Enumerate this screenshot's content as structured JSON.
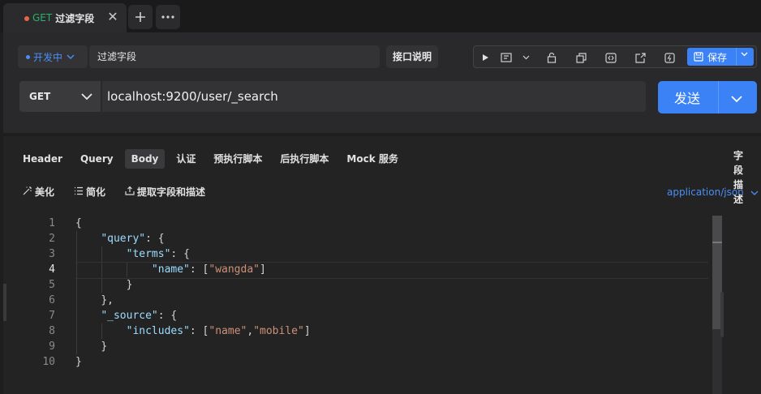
{
  "tab": {
    "method": "GET",
    "title": "过滤字段"
  },
  "request": {
    "environment": "开发中",
    "name": "过滤字段",
    "doc_button": "接口说明",
    "save_label": "保存",
    "method": "GET",
    "url": "localhost:9200/user/_search",
    "send_label": "发送"
  },
  "body_tabs": [
    "Header",
    "Query",
    "Body",
    "认证",
    "预执行脚本",
    "后执行脚本",
    "Mock 服务"
  ],
  "active_body_tab": "Body",
  "actions": {
    "beautify": "美化",
    "simplify": "简化",
    "extract": "提取字段和描述"
  },
  "content_type": "application/json",
  "side_panel_label": "字段描述",
  "line_numbers": [
    "1",
    "2",
    "3",
    "4",
    "5",
    "6",
    "7",
    "8",
    "9",
    "10"
  ],
  "current_line": 4,
  "code": {
    "l1": "{",
    "l2_key": "\"query\"",
    "l2_rest": ": {",
    "l3_key": "\"terms\"",
    "l3_rest": ": {",
    "l4_key": "\"name\"",
    "l4_colon": ": [",
    "l4_val": "\"wangda\"",
    "l4_end": "]",
    "l5": "}",
    "l6": "},",
    "l7_key": "\"_source\"",
    "l7_rest": ": {",
    "l8_key": "\"includes\"",
    "l8_colon": ": [",
    "l8_v1": "\"name\"",
    "l8_comma": ",",
    "l8_v2": "\"mobile\"",
    "l8_end": "]",
    "l9": "}",
    "l10": "}"
  },
  "colors": {
    "accent": "#3b82f6",
    "method_get": "#28b26b",
    "unsaved_dot": "#e5664a",
    "json_key": "#9cdcfe",
    "json_string": "#ce9178"
  }
}
